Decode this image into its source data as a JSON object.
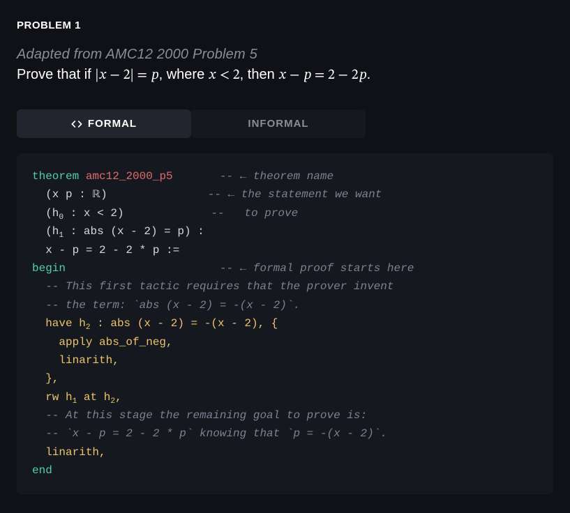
{
  "heading": "PROBLEM 1",
  "subtitle": "Adapted from AMC12 2000 Problem 5",
  "prompt_lead": "Prove that if ",
  "prompt_math1": "|𝑥 − 2| = 𝑝",
  "prompt_mid1": ", where ",
  "prompt_math2": "𝑥 < 2",
  "prompt_mid2": ", then ",
  "prompt_math3": "𝑥 − 𝑝 = 2 − 2𝑝",
  "prompt_tail": ".",
  "tabs": {
    "formal": "FORMAL",
    "informal": "INFORMAL"
  },
  "code": {
    "l1_kw": "theorem",
    "l1_name": "amc12_2000_p5",
    "l1_cmt": "-- ← theorem name",
    "l2_txt": "  (x p : ",
    "l2_bb": "ℝ",
    "l2_txt2": ")",
    "l2_cmt": "-- ← the statement we want",
    "l3_txt": "  (h",
    "l3_sub": "0",
    "l3_txt2": " : x < 2)",
    "l3_cmt": "--   to prove",
    "l4_txt": "  (h",
    "l4_sub": "1",
    "l4_txt2": " : abs (x - 2) = p) :",
    "l5_txt": "  x - p = 2 - 2 * p :=",
    "l6_kw": "begin",
    "l6_cmt": "-- ← formal proof starts here",
    "l7_cmt": "  -- This first tactic requires that the prover invent",
    "l8_cmt": "  -- the term: `abs (x - 2) = -(x - 2)`.",
    "l9a": "  have h",
    "l9sub": "2",
    "l9b": " : abs (x - 2) = -(x - 2), {",
    "l10": "    apply abs_of_neg,",
    "l11": "    linarith,",
    "l12": "  },",
    "l13a": "  rw h",
    "l13s1": "1",
    "l13b": " at h",
    "l13s2": "2",
    "l13c": ",",
    "l14_cmt": "  -- At this stage the remaining goal to prove is:",
    "l15_cmt": "  -- `x - p = 2 - 2 * p` knowing that `p = -(x - 2)`.",
    "l16": "  linarith,",
    "l17_kw": "end"
  }
}
